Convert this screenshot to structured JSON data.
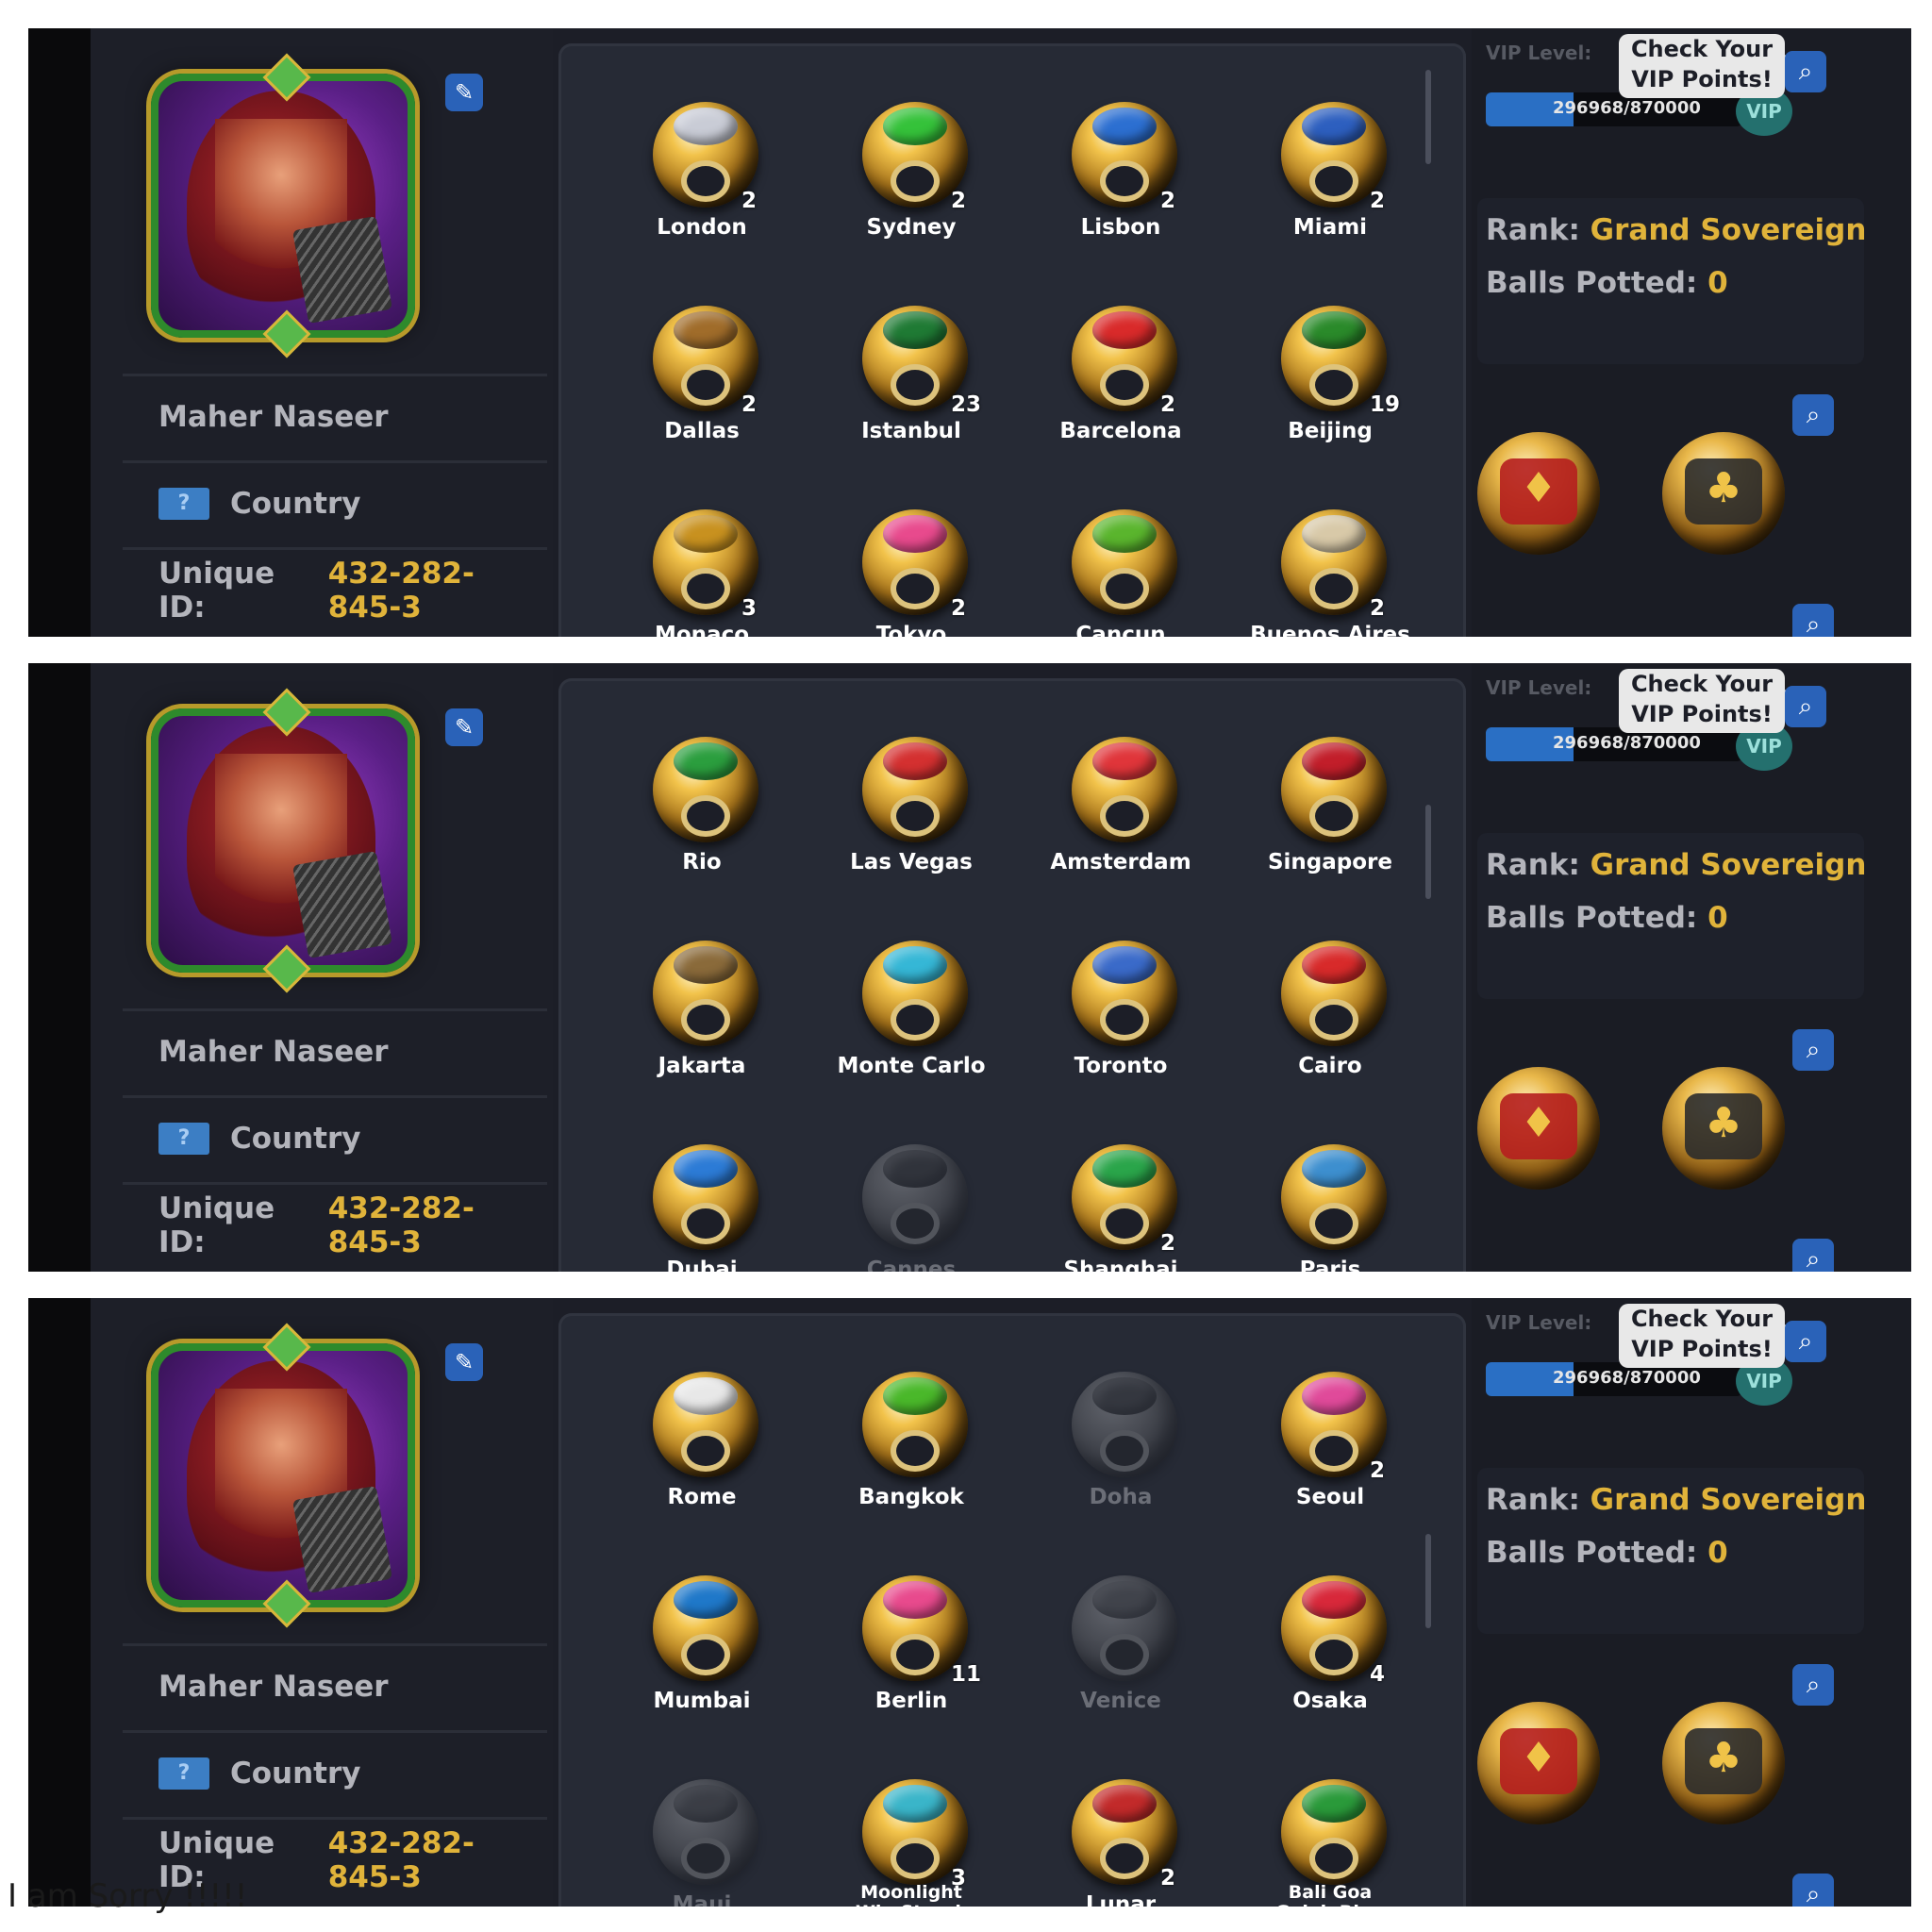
{
  "profile": {
    "name": "Maher Naseer",
    "country_label": "Country",
    "country_flag": "?",
    "unique_id_label": "Unique ID:",
    "unique_id": "432-282-845-3",
    "edit_icon": "pencil-icon"
  },
  "vip": {
    "label": "VIP Level:",
    "points_text": "296968/870000",
    "progress_fraction": 0.341,
    "badge": "VIP",
    "tooltip_line1": "Check Your",
    "tooltip_line2": "VIP Points!"
  },
  "stats": {
    "rank_label": "Rank:",
    "rank_value": "Grand Sovereign",
    "balls_label": "Balls Potted:",
    "balls_value": "0"
  },
  "search_icon": "⌕",
  "panels": [
    {
      "rings": [
        {
          "name": "London",
          "count": "2",
          "gem": "#c9ccd6"
        },
        {
          "name": "Sydney",
          "count": "2",
          "gem": "#35c23a"
        },
        {
          "name": "Lisbon",
          "count": "2",
          "gem": "#2c6fd1"
        },
        {
          "name": "Miami",
          "count": "2",
          "gem": "#2d5fbf"
        },
        {
          "name": "Dallas",
          "count": "2",
          "gem": "#a06c2a"
        },
        {
          "name": "Istanbul",
          "count": "23",
          "gem": "#1f7a34"
        },
        {
          "name": "Barcelona",
          "count": "2",
          "gem": "#d92a2a"
        },
        {
          "name": "Beijing",
          "count": "19",
          "gem": "#2a8a2a"
        },
        {
          "name": "Monaco",
          "count": "3",
          "gem": "#c8911f"
        },
        {
          "name": "Tokyo",
          "count": "2",
          "gem": "#e84a8d"
        },
        {
          "name": "Cancun",
          "count": "",
          "gem": "#5ab52d"
        },
        {
          "name": "Buenos Aires",
          "count": "2",
          "gem": "#d8c9a8"
        }
      ]
    },
    {
      "rings": [
        {
          "name": "Rio",
          "count": "",
          "gem": "#2b9e3e"
        },
        {
          "name": "Las Vegas",
          "count": "",
          "gem": "#d43030"
        },
        {
          "name": "Amsterdam",
          "count": "",
          "gem": "#e0353a"
        },
        {
          "name": "Singapore",
          "count": "",
          "gem": "#c21e2a"
        },
        {
          "name": "Jakarta",
          "count": "",
          "gem": "#8a6a3a"
        },
        {
          "name": "Monte Carlo",
          "count": "",
          "gem": "#35b7d6"
        },
        {
          "name": "Toronto",
          "count": "",
          "gem": "#3a6ac9"
        },
        {
          "name": "Cairo",
          "count": "",
          "gem": "#d82a2a"
        },
        {
          "name": "Dubai",
          "count": "",
          "gem": "#2c7bd6"
        },
        {
          "name": "Cannes",
          "count": "",
          "gem": "#b53030",
          "dim": true
        },
        {
          "name": "Shanghai",
          "count": "2",
          "gem": "#2aa54a"
        },
        {
          "name": "Paris",
          "count": "",
          "gem": "#3d8fcf"
        }
      ]
    },
    {
      "rings": [
        {
          "name": "Rome",
          "count": "",
          "gem": "#e8e8e8"
        },
        {
          "name": "Bangkok",
          "count": "",
          "gem": "#4ab82a"
        },
        {
          "name": "Doha",
          "count": "",
          "gem": "#3a5bb8",
          "dim": true
        },
        {
          "name": "Seoul",
          "count": "2",
          "gem": "#e04a9a"
        },
        {
          "name": "Mumbai",
          "count": "",
          "gem": "#1f78c9"
        },
        {
          "name": "Berlin",
          "count": "11",
          "gem": "#e84a8d"
        },
        {
          "name": "Venice",
          "count": "",
          "gem": "#d86a8a",
          "dim": true
        },
        {
          "name": "Osaka",
          "count": "4",
          "gem": "#d8283a"
        },
        {
          "name": "Maui",
          "count": "",
          "gem": "#2a8a4a",
          "dim": true
        },
        {
          "name": "Moonlight\nWin Streak",
          "count": "3",
          "gem": "#3ab5c9",
          "small": true
        },
        {
          "name": "Lunar",
          "count": "2",
          "gem": "#c22a2a"
        },
        {
          "name": "Bali Goa\nGajah Ring",
          "count": "",
          "gem": "#2a9a3a",
          "small": true
        }
      ]
    }
  ],
  "showcase_rings": [
    {
      "icon": "diamond-ring-icon"
    },
    {
      "icon": "club-ring-icon"
    }
  ],
  "footer_note": "I am Sorry !!!!!"
}
